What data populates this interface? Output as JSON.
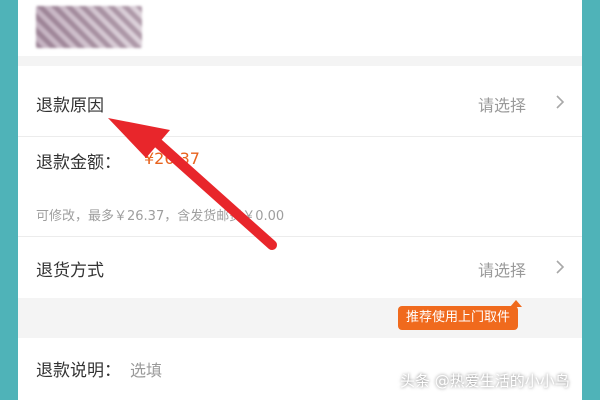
{
  "refund_reason": {
    "label": "退款原因",
    "value": "请选择"
  },
  "refund_amount": {
    "label": "退款金额：",
    "value": "¥26.37"
  },
  "amount_hint": "可修改，最多￥26.37，含发货邮费￥0.00",
  "return_method": {
    "label": "退货方式",
    "value": "请选择"
  },
  "pickup_badge": "推荐使用上门取件",
  "refund_note": {
    "label": "退款说明：",
    "placeholder": "选填"
  },
  "watermark": "头条 @热爱生活的小小鸟",
  "colors": {
    "frame": "#4fb3b8",
    "accent_orange": "#f06a1d",
    "annotation_arrow": "#e8262b"
  },
  "icons": [
    "chevron-right-icon",
    "annotation-arrow-icon"
  ]
}
